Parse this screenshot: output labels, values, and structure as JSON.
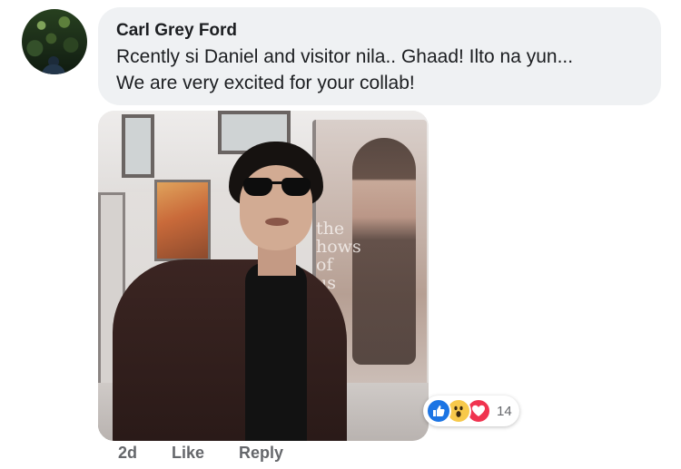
{
  "comment": {
    "author": "Carl Grey Ford",
    "text_line1": "Rcently si Daniel and visitor nila..  Ghaad!  Ilto na yun...",
    "text_line2": "We are very excited for your collab!",
    "photo": {
      "poster_text": [
        "the",
        "hows",
        "of",
        "us"
      ]
    },
    "reactions": {
      "icons": [
        "like-icon",
        "wow-icon",
        "love-icon"
      ],
      "count": "14",
      "colors": {
        "like": "#1b74e4",
        "wow": "#f7c94b",
        "love": "#f0334f"
      }
    },
    "actions": {
      "time": "2d",
      "like_label": "Like",
      "reply_label": "Reply"
    }
  }
}
